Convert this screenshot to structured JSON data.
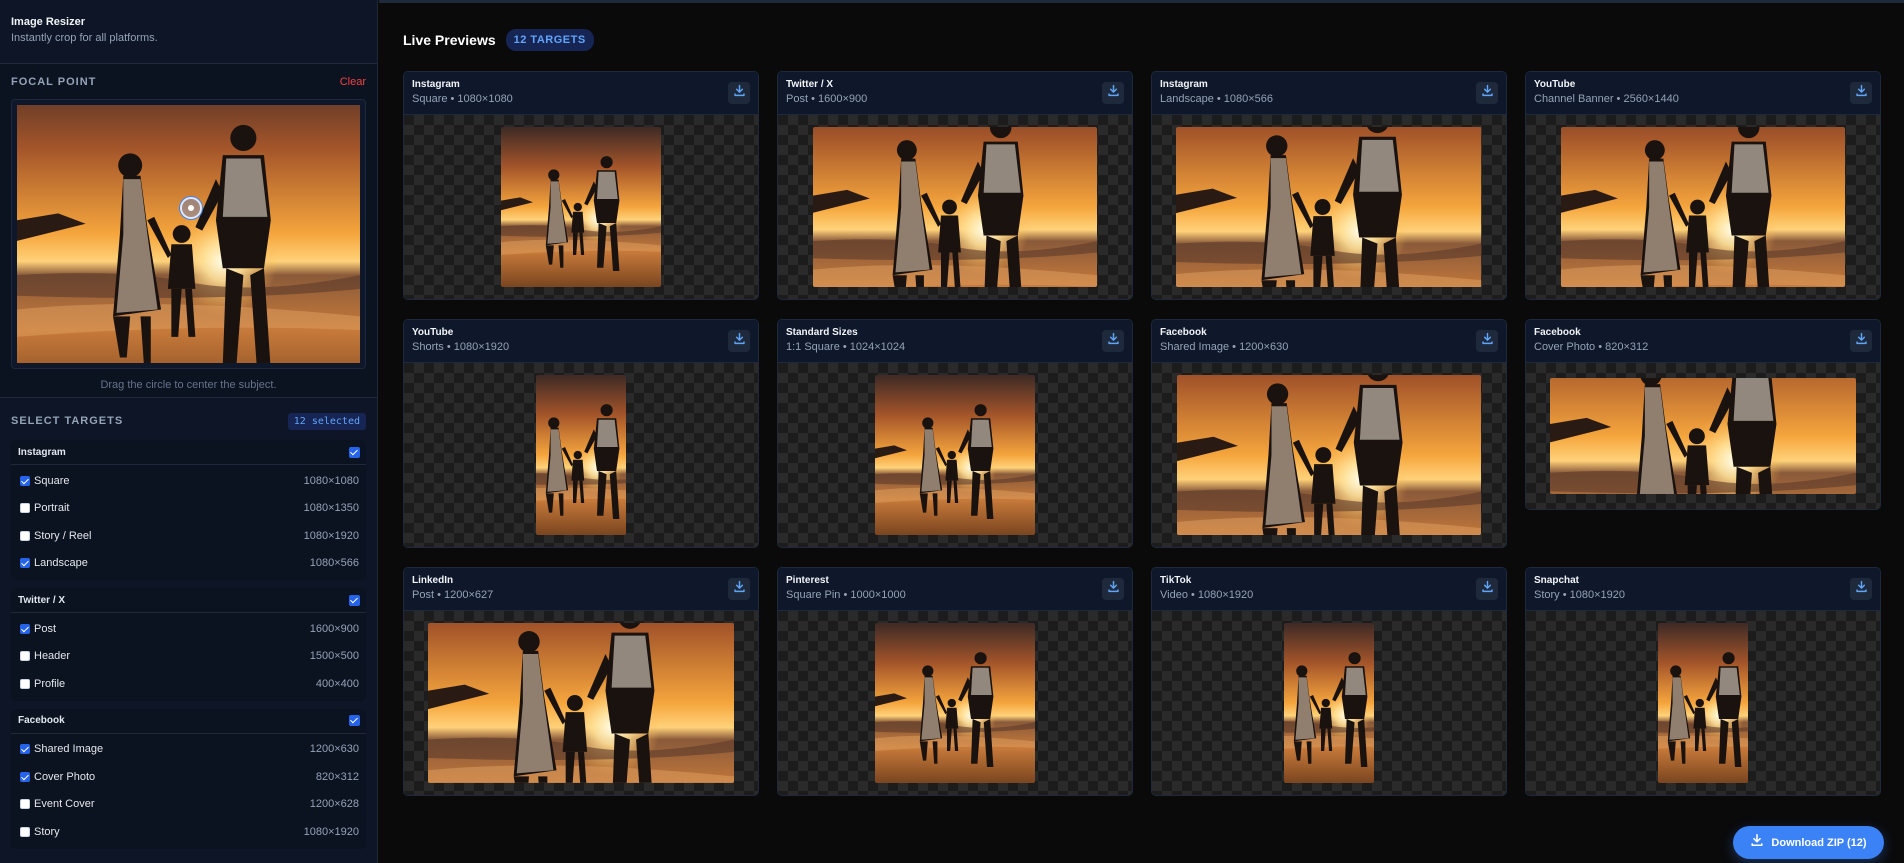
{
  "app": {
    "title": "Image Resizer",
    "subtitle": "Instantly crop for all platforms."
  },
  "focal_point": {
    "title": "FOCAL POINT",
    "clear_label": "Clear",
    "hint": "Drag the circle to center the subject."
  },
  "targets": {
    "title": "SELECT TARGETS",
    "selected_badge": "12 selected",
    "groups": [
      {
        "name": "Instagram",
        "checked": true,
        "options": [
          {
            "label": "Square",
            "size": "1080×1080",
            "checked": true
          },
          {
            "label": "Portrait",
            "size": "1080×1350",
            "checked": false
          },
          {
            "label": "Story / Reel",
            "size": "1080×1920",
            "checked": false
          },
          {
            "label": "Landscape",
            "size": "1080×566",
            "checked": true
          }
        ]
      },
      {
        "name": "Twitter / X",
        "checked": true,
        "options": [
          {
            "label": "Post",
            "size": "1600×900",
            "checked": true
          },
          {
            "label": "Header",
            "size": "1500×500",
            "checked": false
          },
          {
            "label": "Profile",
            "size": "400×400",
            "checked": false
          }
        ]
      },
      {
        "name": "Facebook",
        "checked": true,
        "options": [
          {
            "label": "Shared Image",
            "size": "1200×630",
            "checked": true
          },
          {
            "label": "Cover Photo",
            "size": "820×312",
            "checked": true
          },
          {
            "label": "Event Cover",
            "size": "1200×628",
            "checked": false
          },
          {
            "label": "Story",
            "size": "1080×1920",
            "checked": false
          }
        ]
      }
    ]
  },
  "previews": {
    "title": "Live Previews",
    "count_badge": "12 TARGETS",
    "cards": [
      {
        "platform": "Instagram",
        "spec": "Square • 1080×1080"
      },
      {
        "platform": "Twitter / X",
        "spec": "Post • 1600×900"
      },
      {
        "platform": "Instagram",
        "spec": "Landscape • 1080×566"
      },
      {
        "platform": "YouTube",
        "spec": "Channel Banner • 2560×1440"
      },
      {
        "platform": "YouTube",
        "spec": "Shorts • 1080×1920"
      },
      {
        "platform": "Standard Sizes",
        "spec": "1:1 Square • 1024×1024"
      },
      {
        "platform": "Facebook",
        "spec": "Shared Image • 1200×630"
      },
      {
        "platform": "Facebook",
        "spec": "Cover Photo • 820×312"
      },
      {
        "platform": "LinkedIn",
        "spec": "Post • 1200×627"
      },
      {
        "platform": "Pinterest",
        "spec": "Square Pin • 1000×1000"
      },
      {
        "platform": "TikTok",
        "spec": "Video • 1080×1920"
      },
      {
        "platform": "Snapchat",
        "spec": "Story • 1080×1920"
      }
    ]
  },
  "download_zip_label": "Download ZIP (12)",
  "icons": {
    "card_action": "download-icon",
    "zip_action": "download-icon",
    "focal": "focal-point-handle"
  },
  "colors": {
    "accent": "#3b82f6",
    "danger": "#ef4444",
    "sidebar_bg": "#0d1526",
    "main_bg": "#0a0a0b"
  }
}
